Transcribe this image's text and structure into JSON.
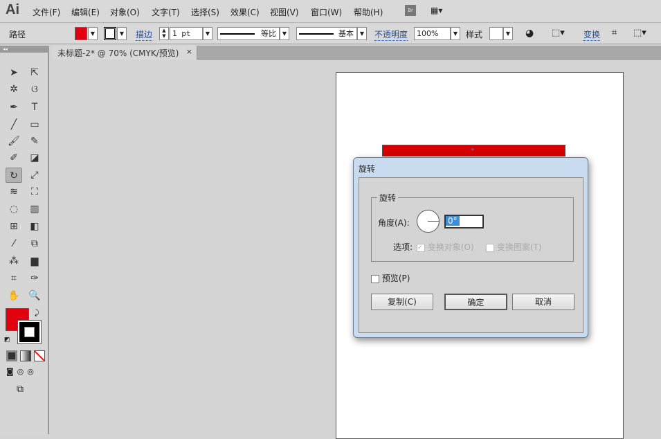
{
  "app": {
    "logo": "Ai",
    "menus": [
      "文件(F)",
      "编辑(E)",
      "对象(O)",
      "文字(T)",
      "选择(S)",
      "效果(C)",
      "视图(V)",
      "窗口(W)",
      "帮助(H)"
    ],
    "bridge": "Br"
  },
  "control": {
    "selection": "路径",
    "stroke_label": "描边",
    "stroke_weight": "1 pt",
    "profile": "等比",
    "brush": "基本",
    "opacity_label": "不透明度",
    "opacity": "100%",
    "style_label": "样式",
    "transform_label": "变换",
    "fill_color": "#e0000f"
  },
  "document": {
    "tab_title": "未标题-2* @ 70% (CMYK/预览)",
    "close": "×"
  },
  "dialog": {
    "title": "旋转",
    "group_label": "旋转",
    "angle_label": "角度(A):",
    "angle_value": "0°",
    "options_label": "选项:",
    "opt_objects": "变换对象(O)",
    "opt_patterns": "变换图案(T)",
    "preview": "预览(P)",
    "copy": "复制(C)",
    "ok": "确定",
    "cancel": "取消"
  }
}
